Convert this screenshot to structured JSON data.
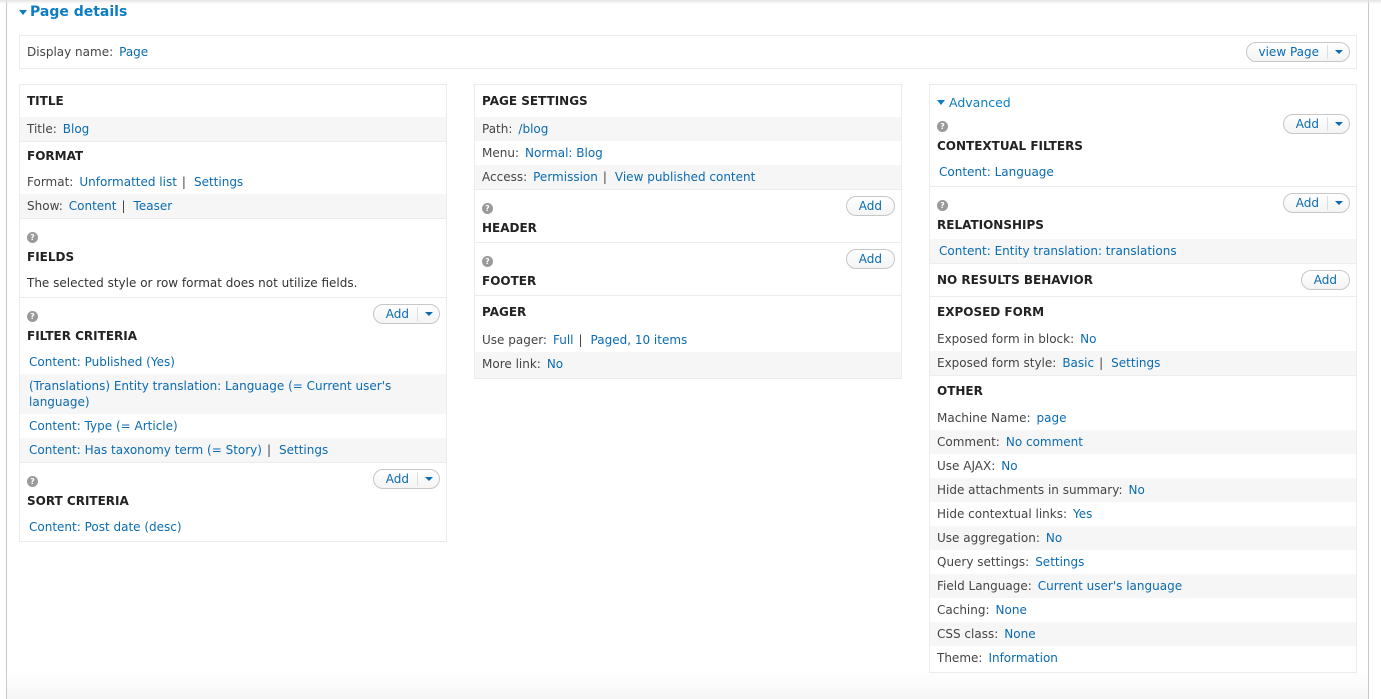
{
  "details": {
    "toggle_label": "Page details"
  },
  "display": {
    "label": "Display name:",
    "value": "Page",
    "view_button": "view Page"
  },
  "buttons": {
    "add": "Add"
  },
  "col1": {
    "title": {
      "heading": "TITLE",
      "label": "Title:",
      "value": "Blog"
    },
    "format": {
      "heading": "FORMAT",
      "format_label": "Format:",
      "format_value": "Unformatted list",
      "format_settings": "Settings",
      "show_label": "Show:",
      "show_value": "Content",
      "show_option": "Teaser"
    },
    "fields": {
      "heading": "FIELDS",
      "text": "The selected style or row format does not utilize fields."
    },
    "filter": {
      "heading": "FILTER CRITERIA",
      "items": [
        "Content: Published (Yes)",
        "(Translations) Entity translation: Language (= Current user's language)",
        "Content: Type (= Article)",
        "Content: Has taxonomy term (= Story)"
      ],
      "item4_settings": "Settings"
    },
    "sort": {
      "heading": "SORT CRITERIA",
      "items": [
        "Content: Post date (desc)"
      ]
    }
  },
  "col2": {
    "page_settings": {
      "heading": "PAGE SETTINGS",
      "path_label": "Path:",
      "path_value": "/blog",
      "menu_label": "Menu:",
      "menu_value": "Normal: Blog",
      "access_label": "Access:",
      "access_value": "Permission",
      "access_option": "View published content"
    },
    "header": {
      "heading": "HEADER"
    },
    "footer": {
      "heading": "FOOTER"
    },
    "pager": {
      "heading": "PAGER",
      "use_label": "Use pager:",
      "use_value": "Full",
      "use_option": "Paged, 10 items",
      "more_label": "More link:",
      "more_value": "No"
    }
  },
  "col3": {
    "advanced_label": "Advanced",
    "contextual": {
      "heading": "CONTEXTUAL FILTERS",
      "items": [
        "Content: Language"
      ]
    },
    "relationships": {
      "heading": "RELATIONSHIPS",
      "items": [
        "Content: Entity translation: translations"
      ]
    },
    "no_results": {
      "heading": "NO RESULTS BEHAVIOR"
    },
    "exposed": {
      "heading": "EXPOSED FORM",
      "block_label": "Exposed form in block:",
      "block_value": "No",
      "style_label": "Exposed form style:",
      "style_value": "Basic",
      "style_settings": "Settings"
    },
    "other": {
      "heading": "OTHER",
      "rows": [
        {
          "label": "Machine Name:",
          "value": "page"
        },
        {
          "label": "Comment:",
          "value": "No comment"
        },
        {
          "label": "Use AJAX:",
          "value": "No"
        },
        {
          "label": "Hide attachments in summary:",
          "value": "No"
        },
        {
          "label": "Hide contextual links:",
          "value": "Yes"
        },
        {
          "label": "Use aggregation:",
          "value": "No"
        },
        {
          "label": "Query settings:",
          "value": "Settings"
        },
        {
          "label": "Field Language:",
          "value": "Current user's language"
        },
        {
          "label": "Caching:",
          "value": "None"
        },
        {
          "label": "CSS class:",
          "value": "None"
        },
        {
          "label": "Theme:",
          "value": "Information"
        }
      ]
    }
  }
}
